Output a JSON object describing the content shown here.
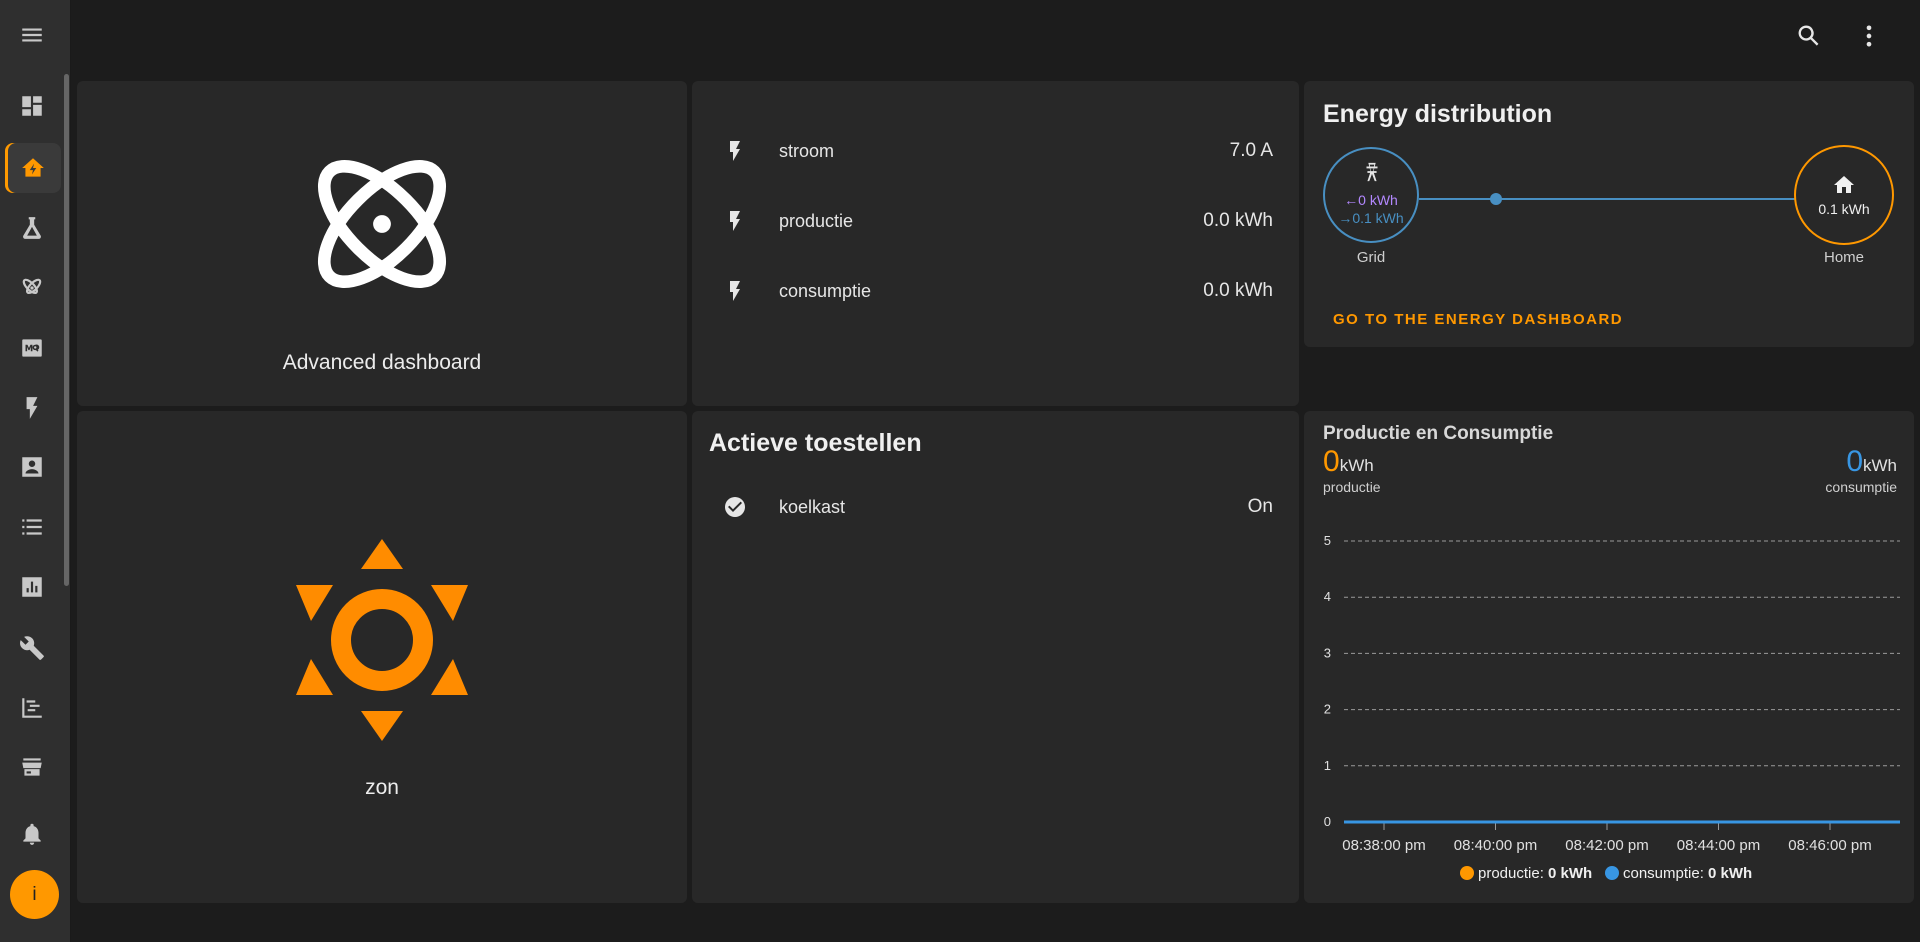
{
  "sidebar": {
    "items": [
      {
        "name": "overview",
        "icon": "dashboard-icon"
      },
      {
        "name": "home",
        "icon": "home-bolt-icon",
        "active": true
      },
      {
        "name": "lab",
        "icon": "flask-icon"
      },
      {
        "name": "advanced",
        "icon": "atom-icon"
      },
      {
        "name": "mqtt",
        "icon": "mq-icon"
      },
      {
        "name": "energy",
        "icon": "flash-icon"
      },
      {
        "name": "people",
        "icon": "account-box-icon"
      },
      {
        "name": "logbook",
        "icon": "list-icon"
      },
      {
        "name": "history",
        "icon": "chart-box-icon"
      },
      {
        "name": "developer-tools",
        "icon": "wrench-icon"
      },
      {
        "name": "addon",
        "icon": "timeline-icon"
      },
      {
        "name": "store",
        "icon": "store-icon"
      },
      {
        "name": "notifications",
        "icon": "bell-icon"
      }
    ],
    "avatar_initial": "i"
  },
  "header": {
    "search_icon": "search-icon",
    "menu_icon": "dots-vertical-icon"
  },
  "cards": {
    "advanced": {
      "label": "Advanced dashboard"
    },
    "zon": {
      "label": "zon"
    },
    "entities": [
      {
        "name": "stroom",
        "value": "7.0 A",
        "icon": "flash-icon"
      },
      {
        "name": "productie",
        "value": "0.0 kWh",
        "icon": "flash-icon"
      },
      {
        "name": "consumptie",
        "value": "0.0 kWh",
        "icon": "flash-icon"
      }
    ],
    "actieve": {
      "title": "Actieve toestellen",
      "rows": [
        {
          "name": "koelkast",
          "value": "On",
          "icon": "check-circle-icon"
        }
      ]
    },
    "energy": {
      "title": "Energy distribution",
      "grid": {
        "label": "Grid",
        "in": "0 kWh",
        "out": "0.1 kWh"
      },
      "home": {
        "label": "Home",
        "value": "0.1 kWh"
      },
      "button": "GO TO THE ENERGY DASHBOARD"
    }
  },
  "colors": {
    "accent": "#ff9800",
    "blue": "#488fc2",
    "purple": "#8e65d4",
    "card": "#282828",
    "background": "#1c1c1c"
  },
  "chart_data": {
    "type": "line",
    "title": "Productie en Consumptie",
    "metrics": [
      {
        "value": "0",
        "unit": "kWh",
        "label": "productie",
        "color": "#ff9800"
      },
      {
        "value": "0",
        "unit": "kWh",
        "label": "consumptie",
        "color": "#3896e3"
      }
    ],
    "x": [
      "08:38:00 pm",
      "08:40:00 pm",
      "08:42:00 pm",
      "08:44:00 pm",
      "08:46:00 pm"
    ],
    "series": [
      {
        "name": "productie",
        "values": [
          0,
          0,
          0,
          0,
          0
        ],
        "color": "#ff9800"
      },
      {
        "name": "consumptie",
        "values": [
          0,
          0,
          0,
          0,
          0
        ],
        "color": "#3896e3"
      }
    ],
    "ylim": [
      0,
      5
    ],
    "yticks": [
      "0",
      "1",
      "2",
      "3",
      "4",
      "5"
    ],
    "grid": true,
    "legend": [
      {
        "name": "productie",
        "value": "0 kWh",
        "color": "#ff9800"
      },
      {
        "name": "consumptie",
        "value": "0 kWh",
        "color": "#3896e3"
      }
    ],
    "legend_position": "bottom"
  }
}
